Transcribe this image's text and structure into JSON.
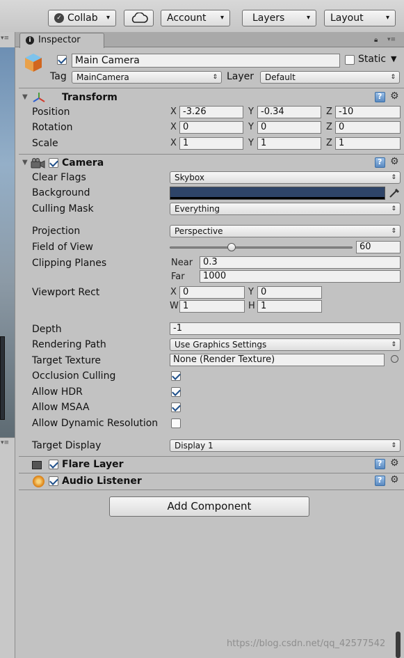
{
  "toolbar": {
    "collab_label": "Collab",
    "account_label": "Account",
    "layers_label": "Layers",
    "layout_label": "Layout",
    "cloud_icon": "cloud-icon"
  },
  "inspector": {
    "tab_label": "Inspector",
    "object": {
      "name": "Main Camera",
      "static_label": "Static",
      "static_checked": false,
      "active_checked": true,
      "tag_label": "Tag",
      "tag_value": "MainCamera",
      "layer_label": "Layer",
      "layer_value": "Default"
    },
    "transform": {
      "title": "Transform",
      "position_label": "Position",
      "rotation_label": "Rotation",
      "scale_label": "Scale",
      "axis_x": "X",
      "axis_y": "Y",
      "axis_z": "Z",
      "position": {
        "x": "-3.26",
        "y": "-0.34",
        "z": "-10"
      },
      "rotation": {
        "x": "0",
        "y": "0",
        "z": "0"
      },
      "scale": {
        "x": "1",
        "y": "1",
        "z": "1"
      }
    },
    "camera": {
      "title": "Camera",
      "enabled": true,
      "clear_flags_label": "Clear Flags",
      "clear_flags_value": "Skybox",
      "background_label": "Background",
      "background_color": "#2e4468",
      "culling_mask_label": "Culling Mask",
      "culling_mask_value": "Everything",
      "projection_label": "Projection",
      "projection_value": "Perspective",
      "fov_label": "Field of View",
      "fov_value": "60",
      "fov_fraction": 0.34,
      "clipping_label": "Clipping Planes",
      "near_label": "Near",
      "near_value": "0.3",
      "far_label": "Far",
      "far_value": "1000",
      "viewport_label": "Viewport Rect",
      "vp_x_label": "X",
      "vp_y_label": "Y",
      "vp_w_label": "W",
      "vp_h_label": "H",
      "vp_x": "0",
      "vp_y": "0",
      "vp_w": "1",
      "vp_h": "1",
      "depth_label": "Depth",
      "depth_value": "-1",
      "rendering_path_label": "Rendering Path",
      "rendering_path_value": "Use Graphics Settings",
      "target_texture_label": "Target Texture",
      "target_texture_value": "None (Render Texture)",
      "occlusion_label": "Occlusion Culling",
      "occlusion_checked": true,
      "hdr_label": "Allow HDR",
      "hdr_checked": true,
      "msaa_label": "Allow MSAA",
      "msaa_checked": true,
      "dynres_label": "Allow Dynamic Resolution",
      "dynres_checked": false,
      "target_display_label": "Target Display",
      "target_display_value": "Display 1"
    },
    "flare_layer": {
      "title": "Flare Layer",
      "enabled": true
    },
    "audio_listener": {
      "title": "Audio Listener",
      "enabled": true
    },
    "add_component_label": "Add Component"
  },
  "watermark": "https://blog.csdn.net/qq_42577542"
}
